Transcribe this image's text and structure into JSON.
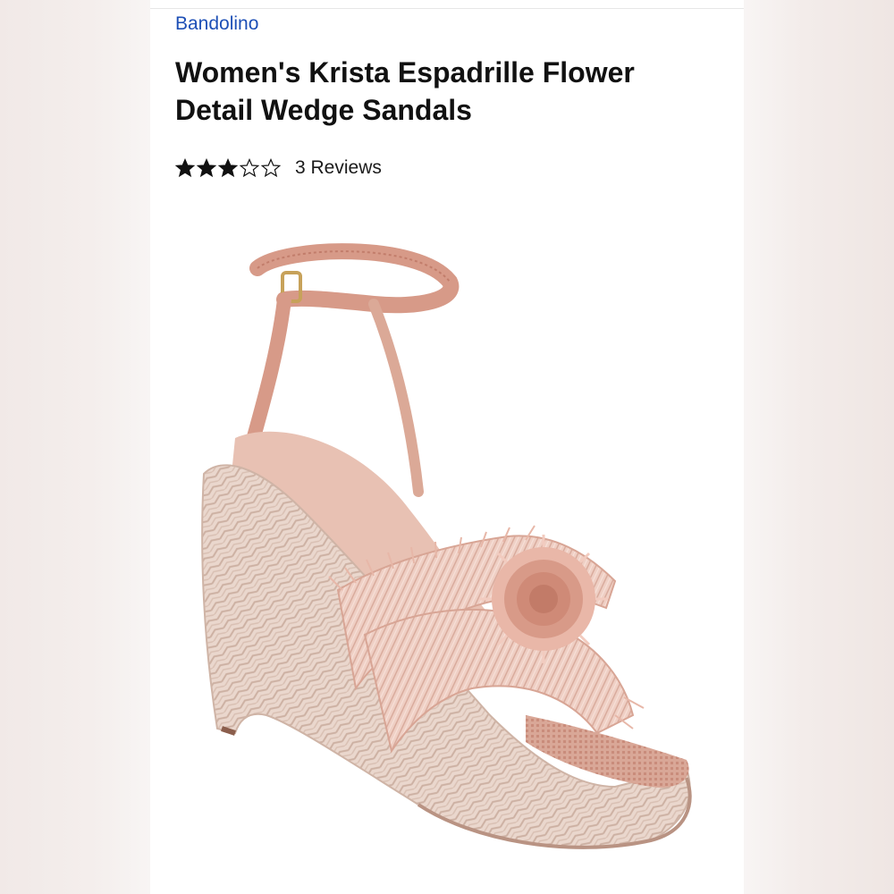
{
  "product": {
    "brand": "Bandolino",
    "title": "Women's Krista Espadrille Flower Detail Wedge Sandals",
    "rating": {
      "value": 3,
      "max": 5,
      "reviews_label": "3 Reviews"
    },
    "image_icon": "wedge-sandal-photo"
  },
  "colors": {
    "brand_link": "#1d4fb6",
    "title_text": "#111111",
    "sandal_blush": "#e9c2b7",
    "jute": "#e7d2c8"
  }
}
